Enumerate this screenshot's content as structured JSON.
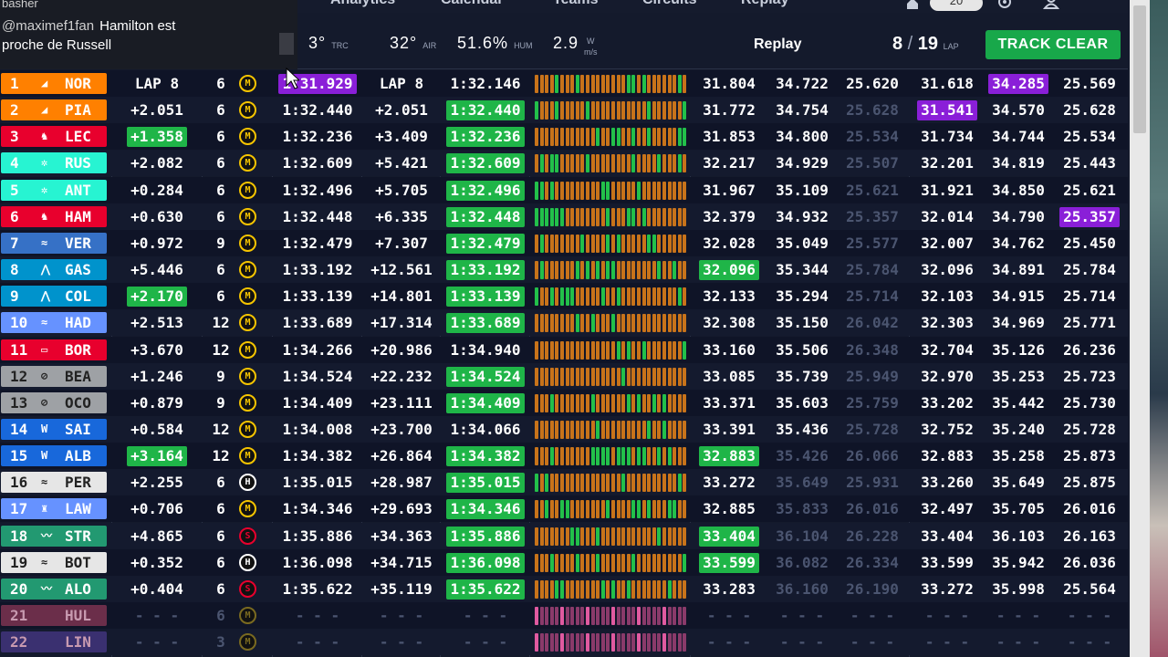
{
  "nav": {
    "items": [
      "Analytics",
      "Calendar",
      "Teams",
      "Circuits",
      "Replay"
    ],
    "pill": "20"
  },
  "chat": {
    "top": "basher",
    "user": "@maximef1fan",
    "line1": "Hamilton est",
    "line2": "proche de Russell"
  },
  "status": {
    "track_temp": "3°",
    "track_label": "TRC",
    "air_temp": "32°",
    "air_label": "AIR",
    "humidity": "51.6%",
    "humidity_label": "HUM",
    "wind": "2.9",
    "wind_unit_top": "W",
    "wind_unit_bottom": "m/s",
    "mode": "Replay",
    "lap_current": "8",
    "lap_total": "19",
    "lap_label": "LAP",
    "track_status": "TRACK CLEAR"
  },
  "colors": {
    "mclaren": "#ff8000",
    "ferrari": "#e8002d",
    "mercedes": "#27f4d2",
    "redbull": "#3671c6",
    "alpine": "#0093cc",
    "haas": "#b6babd",
    "williams": "#1868db",
    "sauber": "#52e252",
    "astonmartin": "#229971",
    "racingbulls": "#6692ff"
  },
  "rows": [
    {
      "pos": "1",
      "logo": "◢",
      "drv": "NOR",
      "team": "#ff8000",
      "gap": "LAP 8",
      "gapHl": "",
      "tyreLaps": "6",
      "tyre": "M",
      "last": "1:31.929",
      "lastHl": "purple",
      "int": "LAP 8",
      "best": "1:32.146",
      "bestHl": "",
      "s1": "31.804",
      "s1Hl": "",
      "s2": "34.722",
      "s2dim": false,
      "s3": "25.620",
      "s3dim": false,
      "b1": "31.618",
      "b1Hl": "",
      "b2": "34.285",
      "b2Hl": "purple",
      "b3": "25.569",
      "b3Hl": ""
    },
    {
      "pos": "2",
      "logo": "◢",
      "drv": "PIA",
      "team": "#ff8000",
      "gap": "+2.051",
      "gapHl": "",
      "tyreLaps": "6",
      "tyre": "M",
      "last": "1:32.440",
      "lastHl": "",
      "int": "+2.051",
      "best": "1:32.440",
      "bestHl": "green",
      "s1": "31.772",
      "s1Hl": "",
      "s2": "34.754",
      "s2dim": false,
      "s3": "25.628",
      "s3dim": true,
      "b1": "31.541",
      "b1Hl": "purple",
      "b2": "34.570",
      "b2Hl": "",
      "b3": "25.628",
      "b3Hl": ""
    },
    {
      "pos": "3",
      "logo": "♞",
      "drv": "LEC",
      "team": "#e8002d",
      "gap": "+1.358",
      "gapHl": "green",
      "tyreLaps": "6",
      "tyre": "M",
      "last": "1:32.236",
      "lastHl": "",
      "int": "+3.409",
      "best": "1:32.236",
      "bestHl": "green",
      "s1": "31.853",
      "s1Hl": "",
      "s2": "34.800",
      "s2dim": false,
      "s3": "25.534",
      "s3dim": true,
      "b1": "31.734",
      "b1Hl": "",
      "b2": "34.744",
      "b2Hl": "",
      "b3": "25.534",
      "b3Hl": ""
    },
    {
      "pos": "4",
      "logo": "✲",
      "drv": "RUS",
      "team": "#27f4d2",
      "gap": "+2.082",
      "gapHl": "",
      "tyreLaps": "6",
      "tyre": "M",
      "last": "1:32.609",
      "lastHl": "",
      "int": "+5.421",
      "best": "1:32.609",
      "bestHl": "green",
      "s1": "32.217",
      "s1Hl": "",
      "s2": "34.929",
      "s2dim": false,
      "s3": "25.507",
      "s3dim": true,
      "b1": "32.201",
      "b1Hl": "",
      "b2": "34.819",
      "b2Hl": "",
      "b3": "25.443",
      "b3Hl": ""
    },
    {
      "pos": "5",
      "logo": "✲",
      "drv": "ANT",
      "team": "#27f4d2",
      "gap": "+0.284",
      "gapHl": "",
      "tyreLaps": "6",
      "tyre": "M",
      "last": "1:32.496",
      "lastHl": "",
      "int": "+5.705",
      "best": "1:32.496",
      "bestHl": "green",
      "s1": "31.967",
      "s1Hl": "",
      "s2": "35.109",
      "s2dim": false,
      "s3": "25.621",
      "s3dim": true,
      "b1": "31.921",
      "b1Hl": "",
      "b2": "34.850",
      "b2Hl": "",
      "b3": "25.621",
      "b3Hl": ""
    },
    {
      "pos": "6",
      "logo": "♞",
      "drv": "HAM",
      "team": "#e8002d",
      "gap": "+0.630",
      "gapHl": "",
      "tyreLaps": "6",
      "tyre": "M",
      "last": "1:32.448",
      "lastHl": "",
      "int": "+6.335",
      "best": "1:32.448",
      "bestHl": "green",
      "s1": "32.379",
      "s1Hl": "",
      "s2": "34.932",
      "s2dim": false,
      "s3": "25.357",
      "s3dim": true,
      "b1": "32.014",
      "b1Hl": "",
      "b2": "34.790",
      "b2Hl": "",
      "b3": "25.357",
      "b3Hl": "purple"
    },
    {
      "pos": "7",
      "logo": "≈",
      "drv": "VER",
      "team": "#3671c6",
      "gap": "+0.972",
      "gapHl": "",
      "tyreLaps": "9",
      "tyre": "M",
      "last": "1:32.479",
      "lastHl": "",
      "int": "+7.307",
      "best": "1:32.479",
      "bestHl": "green",
      "s1": "32.028",
      "s1Hl": "",
      "s2": "35.049",
      "s2dim": false,
      "s3": "25.577",
      "s3dim": true,
      "b1": "32.007",
      "b1Hl": "",
      "b2": "34.762",
      "b2Hl": "",
      "b3": "25.450",
      "b3Hl": ""
    },
    {
      "pos": "8",
      "logo": "⋀",
      "drv": "GAS",
      "team": "#0093cc",
      "gap": "+5.446",
      "gapHl": "",
      "tyreLaps": "6",
      "tyre": "M",
      "last": "1:33.192",
      "lastHl": "",
      "int": "+12.561",
      "best": "1:33.192",
      "bestHl": "green",
      "s1": "32.096",
      "s1Hl": "green",
      "s2": "35.344",
      "s2dim": false,
      "s3": "25.784",
      "s3dim": true,
      "b1": "32.096",
      "b1Hl": "",
      "b2": "34.891",
      "b2Hl": "",
      "b3": "25.784",
      "b3Hl": ""
    },
    {
      "pos": "9",
      "logo": "⋀",
      "drv": "COL",
      "team": "#0093cc",
      "gap": "+2.170",
      "gapHl": "green",
      "tyreLaps": "6",
      "tyre": "M",
      "last": "1:33.139",
      "lastHl": "",
      "int": "+14.801",
      "best": "1:33.139",
      "bestHl": "green",
      "s1": "32.133",
      "s1Hl": "",
      "s2": "35.294",
      "s2dim": false,
      "s3": "25.714",
      "s3dim": true,
      "b1": "32.103",
      "b1Hl": "",
      "b2": "34.915",
      "b2Hl": "",
      "b3": "25.714",
      "b3Hl": ""
    },
    {
      "pos": "10",
      "logo": "≈",
      "drv": "HAD",
      "team": "#6692ff",
      "gap": "+2.513",
      "gapHl": "",
      "tyreLaps": "12",
      "tyre": "M",
      "last": "1:33.689",
      "lastHl": "",
      "int": "+17.314",
      "best": "1:33.689",
      "bestHl": "green",
      "s1": "32.308",
      "s1Hl": "",
      "s2": "35.150",
      "s2dim": false,
      "s3": "26.042",
      "s3dim": true,
      "b1": "32.303",
      "b1Hl": "",
      "b2": "34.969",
      "b2Hl": "",
      "b3": "25.771",
      "b3Hl": ""
    },
    {
      "pos": "11",
      "logo": "▭",
      "drv": "BOR",
      "team": "#e8002d",
      "gap": "+3.670",
      "gapHl": "",
      "tyreLaps": "12",
      "tyre": "M",
      "last": "1:34.266",
      "lastHl": "",
      "int": "+20.986",
      "best": "1:34.940",
      "bestHl": "",
      "s1": "33.160",
      "s1Hl": "",
      "s2": "35.506",
      "s2dim": false,
      "s3": "26.348",
      "s3dim": true,
      "b1": "32.704",
      "b1Hl": "",
      "b2": "35.126",
      "b2Hl": "",
      "b3": "26.236",
      "b3Hl": ""
    },
    {
      "pos": "12",
      "logo": "⊘",
      "drv": "BEA",
      "team": "#9ea1a5",
      "gap": "+1.246",
      "gapHl": "",
      "tyreLaps": "9",
      "tyre": "M",
      "last": "1:34.524",
      "lastHl": "",
      "int": "+22.232",
      "best": "1:34.524",
      "bestHl": "green",
      "s1": "33.085",
      "s1Hl": "",
      "s2": "35.739",
      "s2dim": false,
      "s3": "25.949",
      "s3dim": true,
      "b1": "32.970",
      "b1Hl": "",
      "b2": "35.253",
      "b2Hl": "",
      "b3": "25.723",
      "b3Hl": ""
    },
    {
      "pos": "13",
      "logo": "⊘",
      "drv": "OCO",
      "team": "#9ea1a5",
      "gap": "+0.879",
      "gapHl": "",
      "tyreLaps": "9",
      "tyre": "M",
      "last": "1:34.409",
      "lastHl": "",
      "int": "+23.111",
      "best": "1:34.409",
      "bestHl": "green",
      "s1": "33.371",
      "s1Hl": "",
      "s2": "35.603",
      "s2dim": false,
      "s3": "25.759",
      "s3dim": true,
      "b1": "33.202",
      "b1Hl": "",
      "b2": "35.442",
      "b2Hl": "",
      "b3": "25.730",
      "b3Hl": ""
    },
    {
      "pos": "14",
      "logo": "W",
      "drv": "SAI",
      "team": "#1868db",
      "gap": "+0.584",
      "gapHl": "",
      "tyreLaps": "12",
      "tyre": "M",
      "last": "1:34.008",
      "lastHl": "",
      "int": "+23.700",
      "best": "1:34.066",
      "bestHl": "",
      "s1": "33.391",
      "s1Hl": "",
      "s2": "35.436",
      "s2dim": false,
      "s3": "25.728",
      "s3dim": true,
      "b1": "32.752",
      "b1Hl": "",
      "b2": "35.240",
      "b2Hl": "",
      "b3": "25.728",
      "b3Hl": ""
    },
    {
      "pos": "15",
      "logo": "W",
      "drv": "ALB",
      "team": "#1868db",
      "gap": "+3.164",
      "gapHl": "green",
      "tyreLaps": "12",
      "tyre": "M",
      "last": "1:34.382",
      "lastHl": "",
      "int": "+26.864",
      "best": "1:34.382",
      "bestHl": "green",
      "s1": "32.883",
      "s1Hl": "green",
      "s2": "35.426",
      "s2dim": true,
      "s3": "26.066",
      "s3dim": true,
      "b1": "32.883",
      "b1Hl": "",
      "b2": "35.258",
      "b2Hl": "",
      "b3": "25.873",
      "b3Hl": ""
    },
    {
      "pos": "16",
      "logo": "≈",
      "drv": "PER",
      "team": "#e6e6e6",
      "gap": "+2.255",
      "gapHl": "",
      "tyreLaps": "6",
      "tyre": "H",
      "last": "1:35.015",
      "lastHl": "",
      "int": "+28.987",
      "best": "1:35.015",
      "bestHl": "green",
      "s1": "33.272",
      "s1Hl": "",
      "s2": "35.649",
      "s2dim": true,
      "s3": "25.931",
      "s3dim": true,
      "b1": "33.260",
      "b1Hl": "",
      "b2": "35.649",
      "b2Hl": "",
      "b3": "25.875",
      "b3Hl": ""
    },
    {
      "pos": "17",
      "logo": "♜",
      "drv": "LAW",
      "team": "#6692ff",
      "gap": "+0.706",
      "gapHl": "",
      "tyreLaps": "6",
      "tyre": "M",
      "last": "1:34.346",
      "lastHl": "",
      "int": "+29.693",
      "best": "1:34.346",
      "bestHl": "green",
      "s1": "32.885",
      "s1Hl": "",
      "s2": "35.833",
      "s2dim": true,
      "s3": "26.016",
      "s3dim": true,
      "b1": "32.497",
      "b1Hl": "",
      "b2": "35.705",
      "b2Hl": "",
      "b3": "26.016",
      "b3Hl": ""
    },
    {
      "pos": "18",
      "logo": "〰",
      "drv": "STR",
      "team": "#229971",
      "gap": "+4.865",
      "gapHl": "",
      "tyreLaps": "6",
      "tyre": "S",
      "last": "1:35.886",
      "lastHl": "",
      "int": "+34.363",
      "best": "1:35.886",
      "bestHl": "green",
      "s1": "33.404",
      "s1Hl": "green",
      "s2": "36.104",
      "s2dim": true,
      "s3": "26.228",
      "s3dim": true,
      "b1": "33.404",
      "b1Hl": "",
      "b2": "36.103",
      "b2Hl": "",
      "b3": "26.163",
      "b3Hl": ""
    },
    {
      "pos": "19",
      "logo": "≈",
      "drv": "BOT",
      "team": "#e6e6e6",
      "gap": "+0.352",
      "gapHl": "",
      "tyreLaps": "6",
      "tyre": "H",
      "last": "1:36.098",
      "lastHl": "",
      "int": "+34.715",
      "best": "1:36.098",
      "bestHl": "green",
      "s1": "33.599",
      "s1Hl": "green",
      "s2": "36.082",
      "s2dim": true,
      "s3": "26.334",
      "s3dim": true,
      "b1": "33.599",
      "b1Hl": "",
      "b2": "35.942",
      "b2Hl": "",
      "b3": "26.036",
      "b3Hl": ""
    },
    {
      "pos": "20",
      "logo": "〰",
      "drv": "ALO",
      "team": "#229971",
      "gap": "+0.404",
      "gapHl": "",
      "tyreLaps": "6",
      "tyre": "S",
      "last": "1:35.622",
      "lastHl": "",
      "int": "+35.119",
      "best": "1:35.622",
      "bestHl": "green",
      "s1": "33.283",
      "s1Hl": "",
      "s2": "36.160",
      "s2dim": true,
      "s3": "26.190",
      "s3dim": true,
      "b1": "33.272",
      "b1Hl": "",
      "b2": "35.998",
      "b2Hl": "",
      "b3": "25.564",
      "b3Hl": ""
    },
    {
      "pos": "21",
      "logo": "",
      "drv": "HUL",
      "team": "#6b2e4a",
      "gap": "- - -",
      "gapHl": "dimtxt",
      "tyreLaps": "6",
      "tyre": "M",
      "last": "- - -",
      "lastHl": "dimtxt",
      "int": "- - -",
      "best": "- - -",
      "bestHl": "dimtxt",
      "s1": "- - -",
      "s1Hl": "dimtxt",
      "s2": "- - -",
      "s2dim": true,
      "s3": "- - -",
      "s3dim": true,
      "b1": "- - -",
      "b1Hl": "dimtxt",
      "b2": "- - -",
      "b2Hl": "dimtxt",
      "b3": "- - -",
      "b3Hl": "dimtxt"
    },
    {
      "pos": "22",
      "logo": "",
      "drv": "LIN",
      "team": "#3a3070",
      "gap": "- - -",
      "gapHl": "dimtxt",
      "tyreLaps": "3",
      "tyre": "M",
      "last": "- - -",
      "lastHl": "dimtxt",
      "int": "- - -",
      "best": "- - -",
      "bestHl": "dimtxt",
      "s1": "- - -",
      "s1Hl": "dimtxt",
      "s2": "- - -",
      "s2dim": true,
      "s3": "- - -",
      "s3dim": true,
      "b1": "- - -",
      "b1Hl": "dimtxt",
      "b2": "- - -",
      "b2Hl": "dimtxt",
      "b3": "- - -",
      "b3Hl": "dimtxt"
    }
  ]
}
